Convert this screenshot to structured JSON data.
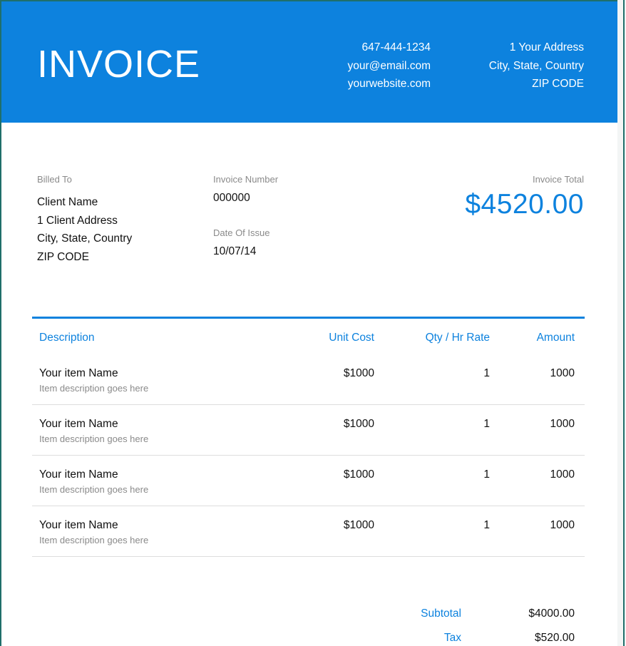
{
  "header": {
    "title": "INVOICE",
    "contact": [
      "647-444-1234",
      "your@email.com",
      "yourwebsite.com"
    ],
    "address": [
      "1 Your Address",
      "City, State, Country",
      "ZIP CODE"
    ]
  },
  "billed_to": {
    "label": "Billed To",
    "lines": [
      "Client Name",
      "1 Client Address",
      "City, State, Country",
      "ZIP CODE"
    ]
  },
  "invoice_number": {
    "label": "Invoice Number",
    "value": "000000"
  },
  "date_of_issue": {
    "label": "Date Of Issue",
    "value": "10/07/14"
  },
  "invoice_total": {
    "label": "Invoice Total",
    "value": "$4520.00"
  },
  "table": {
    "headers": [
      "Description",
      "Unit Cost",
      "Qty / Hr Rate",
      "Amount"
    ],
    "rows": [
      {
        "name": "Your item Name",
        "desc": "Item description goes here",
        "cost": "$1000",
        "qty": "1",
        "amount": "1000"
      },
      {
        "name": "Your item Name",
        "desc": "Item description goes here",
        "cost": "$1000",
        "qty": "1",
        "amount": "1000"
      },
      {
        "name": "Your item Name",
        "desc": "Item description goes here",
        "cost": "$1000",
        "qty": "1",
        "amount": "1000"
      },
      {
        "name": "Your item Name",
        "desc": "Item description goes here",
        "cost": "$1000",
        "qty": "1",
        "amount": "1000"
      }
    ]
  },
  "summary": {
    "subtotal_label": "Subtotal",
    "subtotal_value": "$4000.00",
    "tax_label": "Tax",
    "tax_value": "$520.00"
  },
  "colors": {
    "accent": "#0d82de",
    "border": "#1f6f6a"
  }
}
